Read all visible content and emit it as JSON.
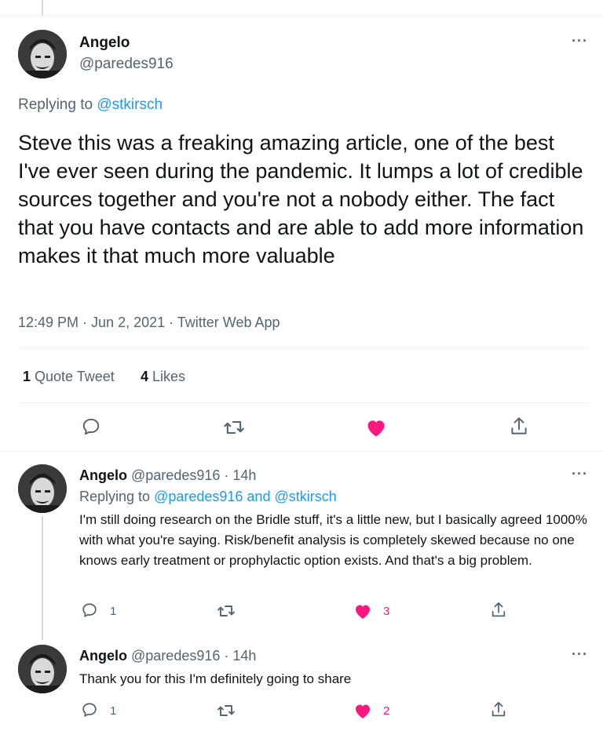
{
  "main_tweet": {
    "name": "Angelo",
    "handle": "@paredes916",
    "replying_prefix": "Replying to ",
    "replying_to": "@stkirsch",
    "text": "Steve this was a freaking amazing article, one of the best I've ever seen during the pandemic. It lumps a lot of credible sources together and you're not a nobody either. The fact that you have contacts and are able to add more information makes it that much more valuable",
    "meta": "12:49 PM · Jun 2, 2021 · Twitter Web App",
    "quote_count": "1",
    "quote_label": "Quote Tweet",
    "likes_count": "4",
    "likes_label": "Likes",
    "more": "···"
  },
  "replies": [
    {
      "name": "Angelo",
      "handle_time": "@paredes916 · 14h",
      "replying_prefix": "Replying to ",
      "replying_to_1": "@paredes916",
      "replying_and": " and ",
      "replying_to_2": "@stkirsch",
      "text": "I'm still doing research on the Bridle stuff, it's a little new, but I basically agreed 1000% with what you're saying. Risk/benefit analysis is completely skewed because no one knows early treatment or prophylactic option exists. And that's a big problem.",
      "reply_count": "1",
      "like_count": "3",
      "more": "···"
    },
    {
      "name": "Angelo",
      "handle_time": "@paredes916 · 14h",
      "text": "Thank you for this I'm definitely going to share",
      "reply_count": "1",
      "like_count": "2",
      "more": "···"
    }
  ],
  "icons": {
    "reply": "reply-icon",
    "retweet": "retweet-icon",
    "like": "heart-icon",
    "share": "share-icon"
  },
  "colors": {
    "link": "#1d9bf0",
    "like": "#f91880",
    "secondary_text": "#536471"
  }
}
